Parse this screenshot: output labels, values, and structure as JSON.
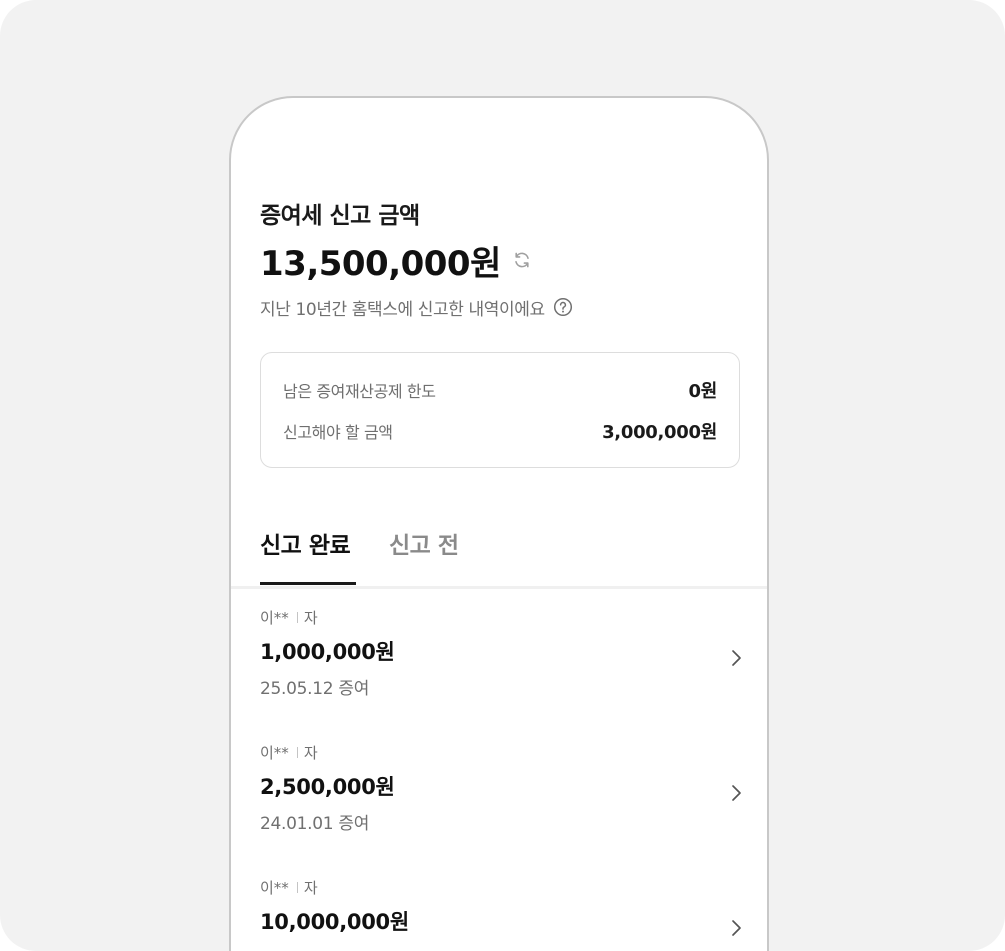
{
  "header": {
    "title": "증여세 신고 금액",
    "total_amount": "13,500,000원",
    "subtitle": "지난 10년간 홈택스에 신고한 내역이에요"
  },
  "icons": {
    "refresh": "refresh-icon",
    "help": "help-circle-icon",
    "chevron": "chevron-right-icon"
  },
  "summary": {
    "rows": [
      {
        "label": "남은 증여재산공제 한도",
        "value": "0원"
      },
      {
        "label": "신고해야 할 금액",
        "value": "3,000,000원"
      }
    ]
  },
  "tabs": [
    {
      "label": "신고 완료",
      "active": true
    },
    {
      "label": "신고 전",
      "active": false
    }
  ],
  "list": {
    "items": [
      {
        "name": "이**",
        "relation": "자",
        "amount": "1,000,000원",
        "date": "25.05.12 증여"
      },
      {
        "name": "이**",
        "relation": "자",
        "amount": "2,500,000원",
        "date": "24.01.01 증여"
      },
      {
        "name": "이**",
        "relation": "자",
        "amount": "10,000,000원",
        "date": ""
      }
    ]
  },
  "colors": {
    "backdrop": "#f2f2f2",
    "text_primary": "#111111",
    "text_secondary": "#707070",
    "tab_inactive": "#8a8a8a",
    "border": "#dddddd"
  }
}
